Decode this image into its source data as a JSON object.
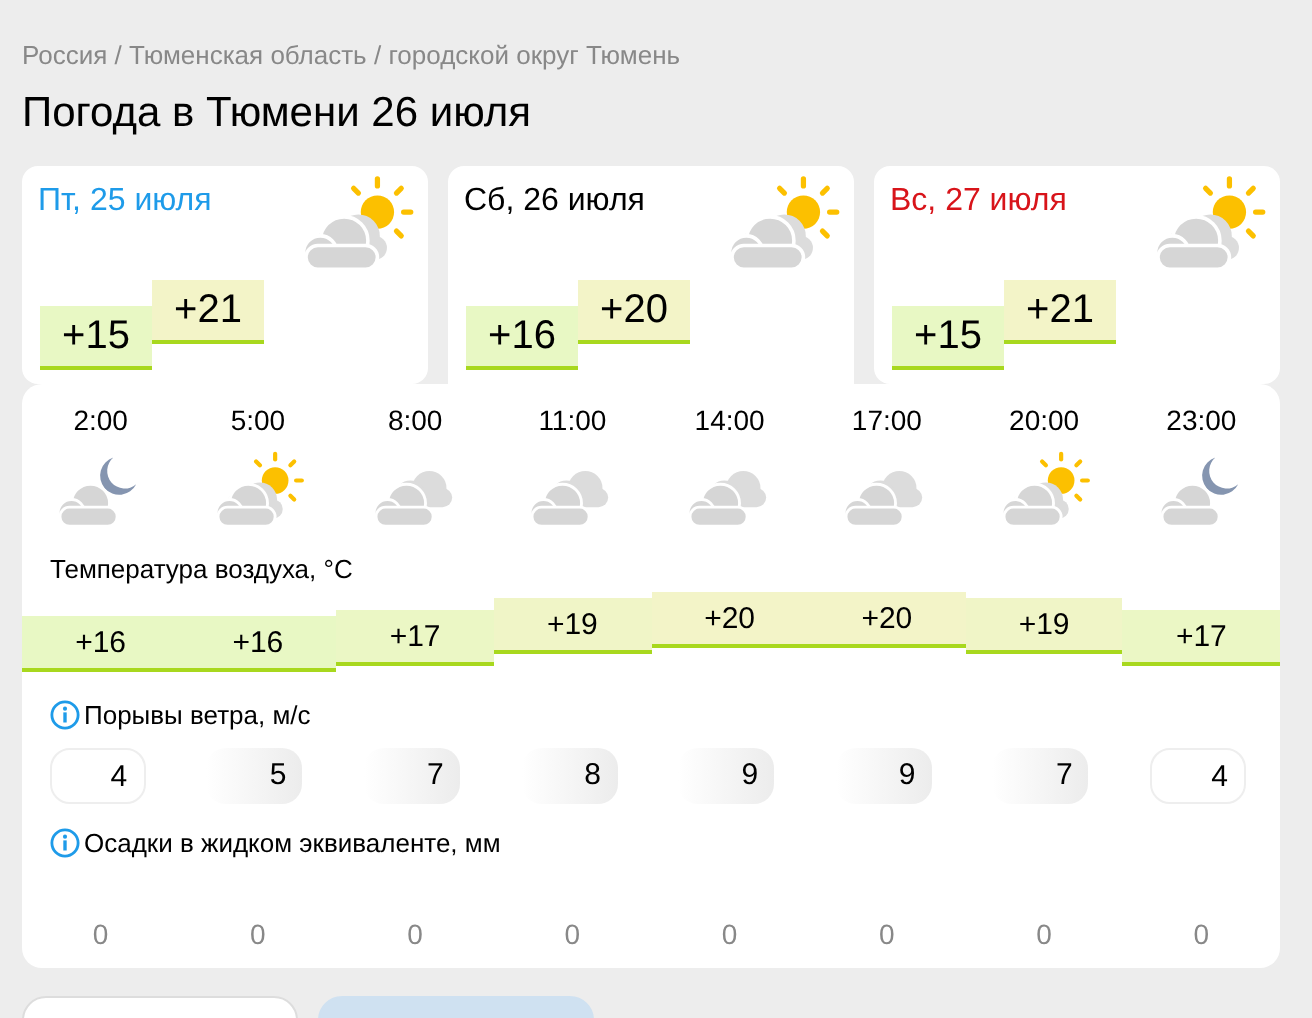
{
  "breadcrumbs": [
    "Россия",
    "Тюменская область",
    "городской округ Тюмень"
  ],
  "breadcrumb_separator": "/",
  "title": "Погода в Тюмени 26 июля",
  "days": [
    {
      "label": "Пт, 25 июля",
      "color": "#1e9be9",
      "selected": false,
      "kind": "partly-cloudy",
      "min": "+15",
      "max": "+21"
    },
    {
      "label": "Сб, 26 июля",
      "color": "#000000",
      "selected": true,
      "kind": "partly-cloudy",
      "min": "+16",
      "max": "+20"
    },
    {
      "label": "Вс, 27 июля",
      "color": "#d8141a",
      "selected": false,
      "kind": "partly-cloudy",
      "min": "+15",
      "max": "+21"
    }
  ],
  "hours": [
    {
      "time": "2:00",
      "kind": "night",
      "temp": "+16",
      "wind": "4",
      "precip": "0"
    },
    {
      "time": "5:00",
      "kind": "partly-cloudy",
      "temp": "+16",
      "wind": "5",
      "precip": "0"
    },
    {
      "time": "8:00",
      "kind": "cloudy",
      "temp": "+17",
      "wind": "7",
      "precip": "0"
    },
    {
      "time": "11:00",
      "kind": "cloudy",
      "temp": "+19",
      "wind": "8",
      "precip": "0"
    },
    {
      "time": "14:00",
      "kind": "cloudy",
      "temp": "+20",
      "wind": "9",
      "precip": "0"
    },
    {
      "time": "17:00",
      "kind": "cloudy",
      "temp": "+20",
      "wind": "9",
      "precip": "0"
    },
    {
      "time": "20:00",
      "kind": "partly-cloudy",
      "temp": "+19",
      "wind": "7",
      "precip": "0"
    },
    {
      "time": "23:00",
      "kind": "night",
      "temp": "+17",
      "wind": "4",
      "precip": "0"
    }
  ],
  "temperature_label": "Температура воздуха, °C",
  "wind_label": "Порывы ветра, м/с",
  "precip_label": "Осадки в жидком эквиваленте, мм",
  "bottom_buttons": [
    {
      "selected": false
    },
    {
      "selected": true
    }
  ]
}
